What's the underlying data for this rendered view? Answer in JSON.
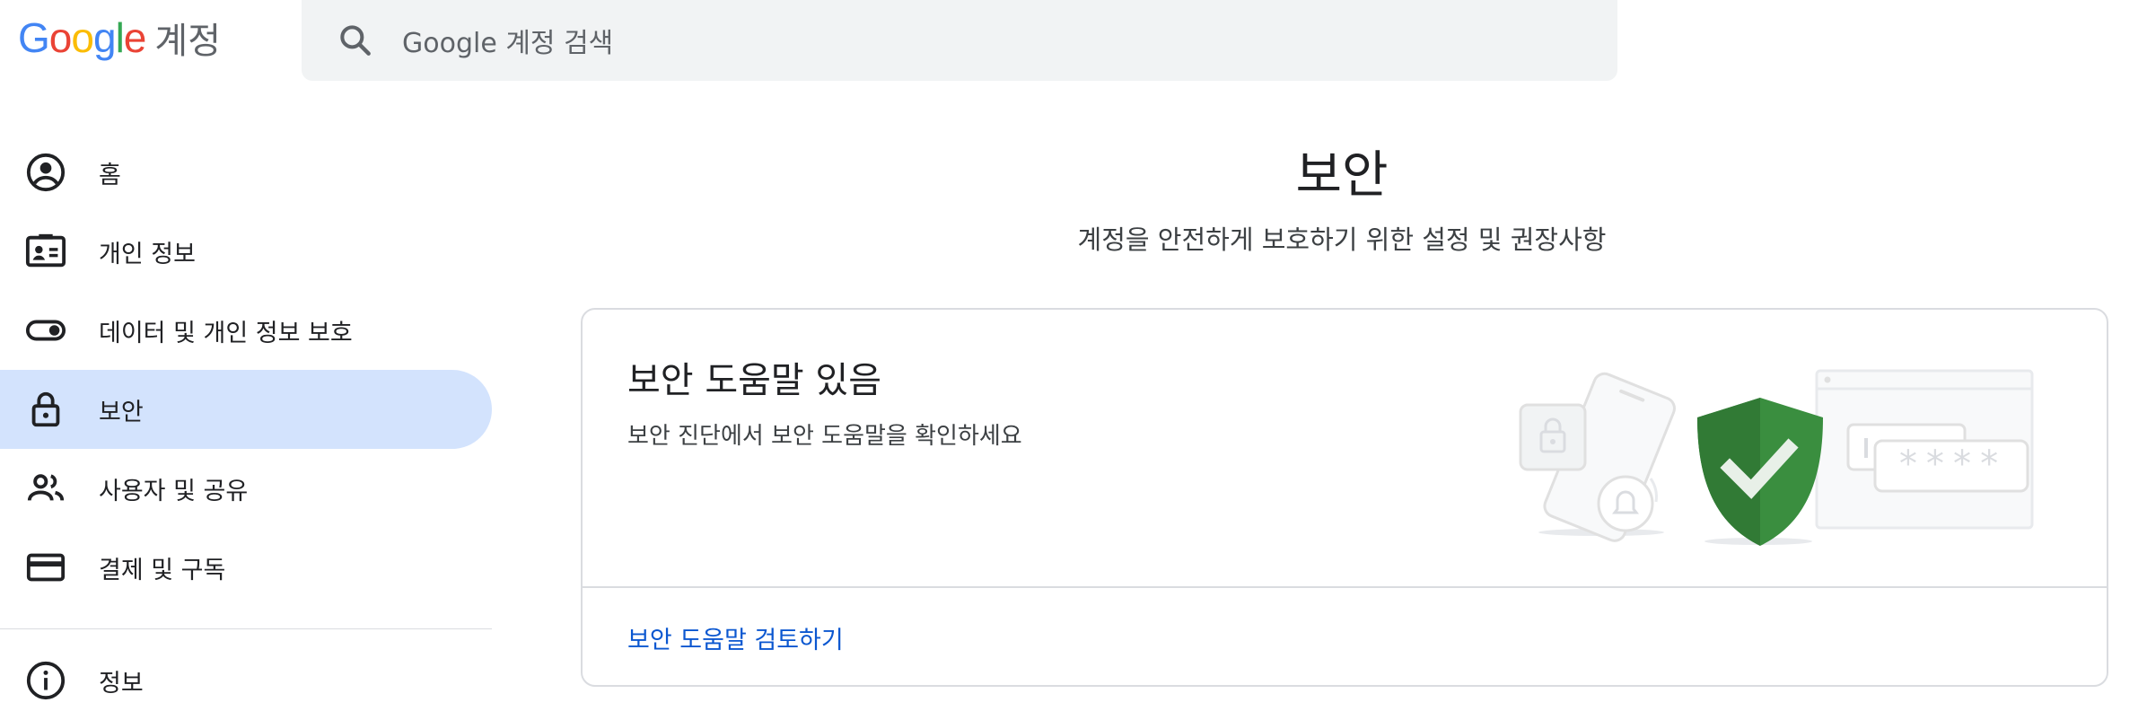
{
  "header": {
    "logo_text": "Google",
    "brand_suffix": "계정",
    "search_placeholder": "Google 계정 검색"
  },
  "sidebar": {
    "items": [
      {
        "label": "홈",
        "icon": "account-circle-icon"
      },
      {
        "label": "개인 정보",
        "icon": "id-card-icon"
      },
      {
        "label": "데이터 및 개인 정보 보호",
        "icon": "toggle-icon"
      },
      {
        "label": "보안",
        "icon": "lock-icon",
        "active": true
      },
      {
        "label": "사용자 및 공유",
        "icon": "people-icon"
      },
      {
        "label": "결제 및 구독",
        "icon": "credit-card-icon"
      },
      {
        "label": "정보",
        "icon": "info-icon"
      }
    ]
  },
  "main": {
    "title": "보안",
    "subtitle": "계정을 안전하게 보호하기 위한 설정 및 권장사항",
    "card": {
      "title": "보안 도움말 있음",
      "description": "보안 진단에서 보안 도움말을 확인하세요",
      "link": "보안 도움말 검토하기",
      "illustration_password_mask": "****"
    }
  },
  "colors": {
    "active_bg": "#d3e3fd",
    "link": "#0b57d0",
    "shield_green": "#3a8e3f",
    "search_bg": "#f1f3f4"
  }
}
